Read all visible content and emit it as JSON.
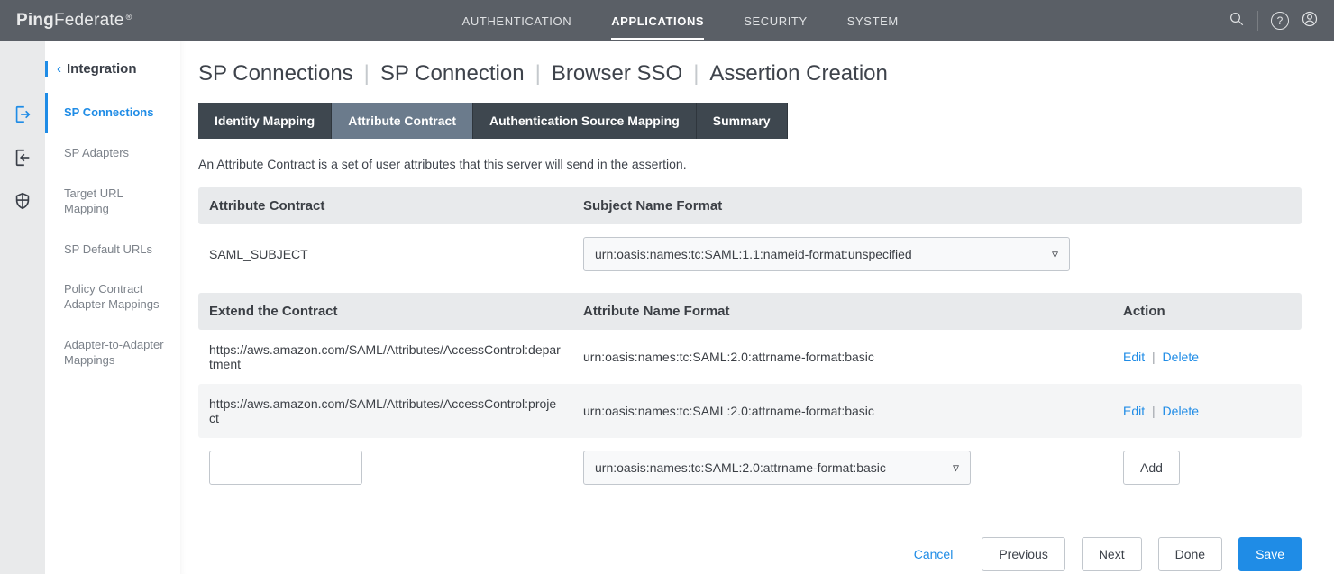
{
  "brand": {
    "name_bold": "Ping",
    "name_rest": "Federate",
    "reg": "®"
  },
  "topnav": [
    {
      "label": "AUTHENTICATION",
      "active": false
    },
    {
      "label": "APPLICATIONS",
      "active": true
    },
    {
      "label": "SECURITY",
      "active": false
    },
    {
      "label": "SYSTEM",
      "active": false
    }
  ],
  "sidebar": {
    "back_label": "Integration",
    "items": [
      {
        "label": "SP Connections",
        "active": true
      },
      {
        "label": "SP Adapters"
      },
      {
        "label": "Target URL Mapping"
      },
      {
        "label": "SP Default URLs"
      },
      {
        "label": "Policy Contract Adapter Mappings"
      },
      {
        "label": "Adapter-to-Adapter Mappings"
      }
    ]
  },
  "breadcrumb": [
    "SP Connections",
    "SP Connection",
    "Browser SSO",
    "Assertion Creation"
  ],
  "steps": [
    {
      "label": "Identity Mapping"
    },
    {
      "label": "Attribute Contract",
      "active": true
    },
    {
      "label": "Authentication Source Mapping"
    },
    {
      "label": "Summary"
    }
  ],
  "description": "An Attribute Contract is a set of user attributes that this server will send in the assertion.",
  "section1": {
    "colA": "Attribute Contract",
    "colB": "Subject Name Format",
    "rows": [
      {
        "name": "SAML_SUBJECT",
        "format_selected": "urn:oasis:names:tc:SAML:1.1:nameid-format:unspecified"
      }
    ]
  },
  "section2": {
    "colA": "Extend the Contract",
    "colB": "Attribute Name Format",
    "colC": "Action",
    "rows": [
      {
        "name": "https://aws.amazon.com/SAML/Attributes/AccessControl:department",
        "format": "urn:oasis:names:tc:SAML:2.0:attrname-format:basic"
      },
      {
        "name": "https://aws.amazon.com/SAML/Attributes/AccessControl:project",
        "format": "urn:oasis:names:tc:SAML:2.0:attrname-format:basic"
      }
    ],
    "new_row": {
      "name_value": "",
      "format_selected": "urn:oasis:names:tc:SAML:2.0:attrname-format:basic"
    },
    "actions": {
      "edit": "Edit",
      "delete": "Delete",
      "add": "Add"
    }
  },
  "footer": {
    "cancel": "Cancel",
    "previous": "Previous",
    "next": "Next",
    "done": "Done",
    "save": "Save"
  }
}
